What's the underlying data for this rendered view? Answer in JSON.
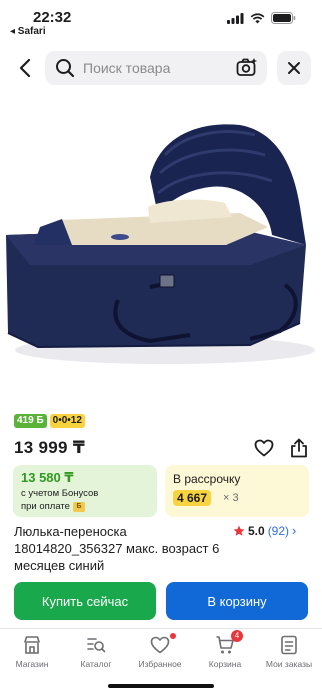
{
  "status_bar": {
    "time": "22:32",
    "back_app": "◂ Safari"
  },
  "search": {
    "placeholder": "Поиск товара"
  },
  "product": {
    "image_alt": "Люлька-переноска",
    "badge_bonus": "419 Б",
    "badge_installment": "0•0•12",
    "price": "13 999 ₸",
    "bonus_card": {
      "price": "13 580 ₸",
      "line1": "с учетом Бонусов",
      "line2": "при оплате"
    },
    "installment_card": {
      "title": "В рассрочку",
      "amount": "4 667",
      "multiplier": "× 3"
    },
    "title": "Люлька-переноска 18014820_356327 макс. возраст 6 месяцев синий",
    "rating": {
      "value": "5.0",
      "count": "(92)"
    }
  },
  "actions": {
    "buy_now": "Купить сейчас",
    "add_to_cart": "В корзину"
  },
  "tabbar": {
    "items": [
      {
        "label": "Магазин"
      },
      {
        "label": "Каталог"
      },
      {
        "label": "Избранное"
      },
      {
        "label": "Корзина",
        "badge": "4"
      },
      {
        "label": "Мои заказы"
      }
    ]
  },
  "colors": {
    "green": "#19a84b",
    "blue": "#1169d8",
    "rating_star": "#e7373c",
    "carrier_navy": "#1f2a55",
    "carrier_beige": "#e6dcc4"
  }
}
